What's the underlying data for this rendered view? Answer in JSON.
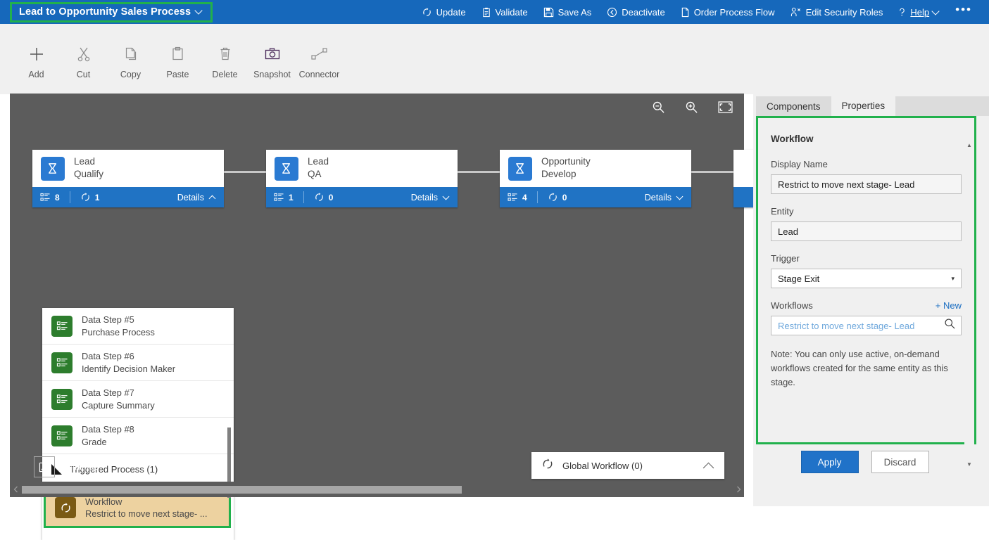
{
  "topbar": {
    "process_title": "Lead to Opportunity Sales Process",
    "title_chevron": "chevron-down-icon",
    "highlight_color": "#21b14c",
    "background": "#1668bb",
    "actions": [
      {
        "label": "Update",
        "icon": "refresh-icon"
      },
      {
        "label": "Validate",
        "icon": "clipboard-check-icon"
      },
      {
        "label": "Save As",
        "icon": "save-icon"
      },
      {
        "label": "Deactivate",
        "icon": "back-circle-icon"
      },
      {
        "label": "Order Process Flow",
        "icon": "document-icon"
      },
      {
        "label": "Edit Security Roles",
        "icon": "people-icon"
      },
      {
        "label": "Help",
        "icon": "question-icon"
      }
    ],
    "overflow": "•••"
  },
  "toolbar": {
    "items": [
      {
        "label": "Add",
        "icon": "plus-icon"
      },
      {
        "label": "Cut",
        "icon": "scissors-icon"
      },
      {
        "label": "Copy",
        "icon": "copy-icon"
      },
      {
        "label": "Paste",
        "icon": "paste-icon"
      },
      {
        "label": "Delete",
        "icon": "trash-icon"
      },
      {
        "label": "Snapshot",
        "icon": "camera-icon"
      },
      {
        "label": "Connector",
        "icon": "connector-icon"
      }
    ]
  },
  "canvas": {
    "background": "#5c5c5c",
    "zoom_controls": [
      {
        "name": "zoom-out-icon"
      },
      {
        "name": "zoom-in-icon"
      },
      {
        "name": "fit-to-screen-icon"
      }
    ],
    "stages": [
      {
        "entity": "Lead",
        "name": "Qualify",
        "steps_count": "8",
        "workflow_count": "1",
        "details_label": "Details",
        "expanded": true,
        "chevron": "chevron-up-icon"
      },
      {
        "entity": "Lead",
        "name": "QA",
        "steps_count": "1",
        "workflow_count": "0",
        "details_label": "Details",
        "expanded": false,
        "chevron": "chevron-down-icon"
      },
      {
        "entity": "Opportunity",
        "name": "Develop",
        "steps_count": "4",
        "workflow_count": "0",
        "details_label": "Details",
        "expanded": false,
        "chevron": "chevron-down-icon"
      }
    ],
    "steps_list": [
      {
        "title": "Data Step #5",
        "subtitle": "Purchase Process",
        "icon": "data-step-icon"
      },
      {
        "title": "Data Step #6",
        "subtitle": "Identify Decision Maker",
        "icon": "data-step-icon"
      },
      {
        "title": "Data Step #7",
        "subtitle": "Capture Summary",
        "icon": "data-step-icon"
      },
      {
        "title": "Data Step #8",
        "subtitle": "Grade",
        "icon": "data-step-icon"
      }
    ],
    "triggered_process_label": "Triggered Process (1)",
    "selected_workflow": {
      "title": "Workflow",
      "subtitle": "Restrict to move next stage- ...",
      "icon": "workflow-icon",
      "selected": true,
      "background": "#edd2a0",
      "highlight_color": "#21b14c"
    },
    "minimap_label": "Minimap",
    "minimap_icon": "minimap-icon",
    "global_workflow": {
      "label": "Global Workflow (0)",
      "icon": "workflow-icon",
      "chevron": "chevron-up-icon"
    }
  },
  "properties_panel": {
    "tabs": [
      {
        "label": "Components",
        "active": false
      },
      {
        "label": "Properties",
        "active": true
      }
    ],
    "title": "Workflow",
    "highlight_color": "#21b14c",
    "fields": {
      "display_name_label": "Display Name",
      "display_name_value": "Restrict to move next stage- Lead",
      "entity_label": "Entity",
      "entity_value": "Lead",
      "trigger_label": "Trigger",
      "trigger_value": "Stage Exit",
      "trigger_arrow": "▾",
      "workflows_label": "Workflows",
      "new_link_label": "+ New",
      "workflow_search_placeholder": "Restrict to move next stage- Lead",
      "search_icon": "magnifier-icon"
    },
    "note": "Note: You can only use active, on-demand workflows created for the same entity as this stage.",
    "apply_label": "Apply",
    "discard_label": "Discard"
  }
}
